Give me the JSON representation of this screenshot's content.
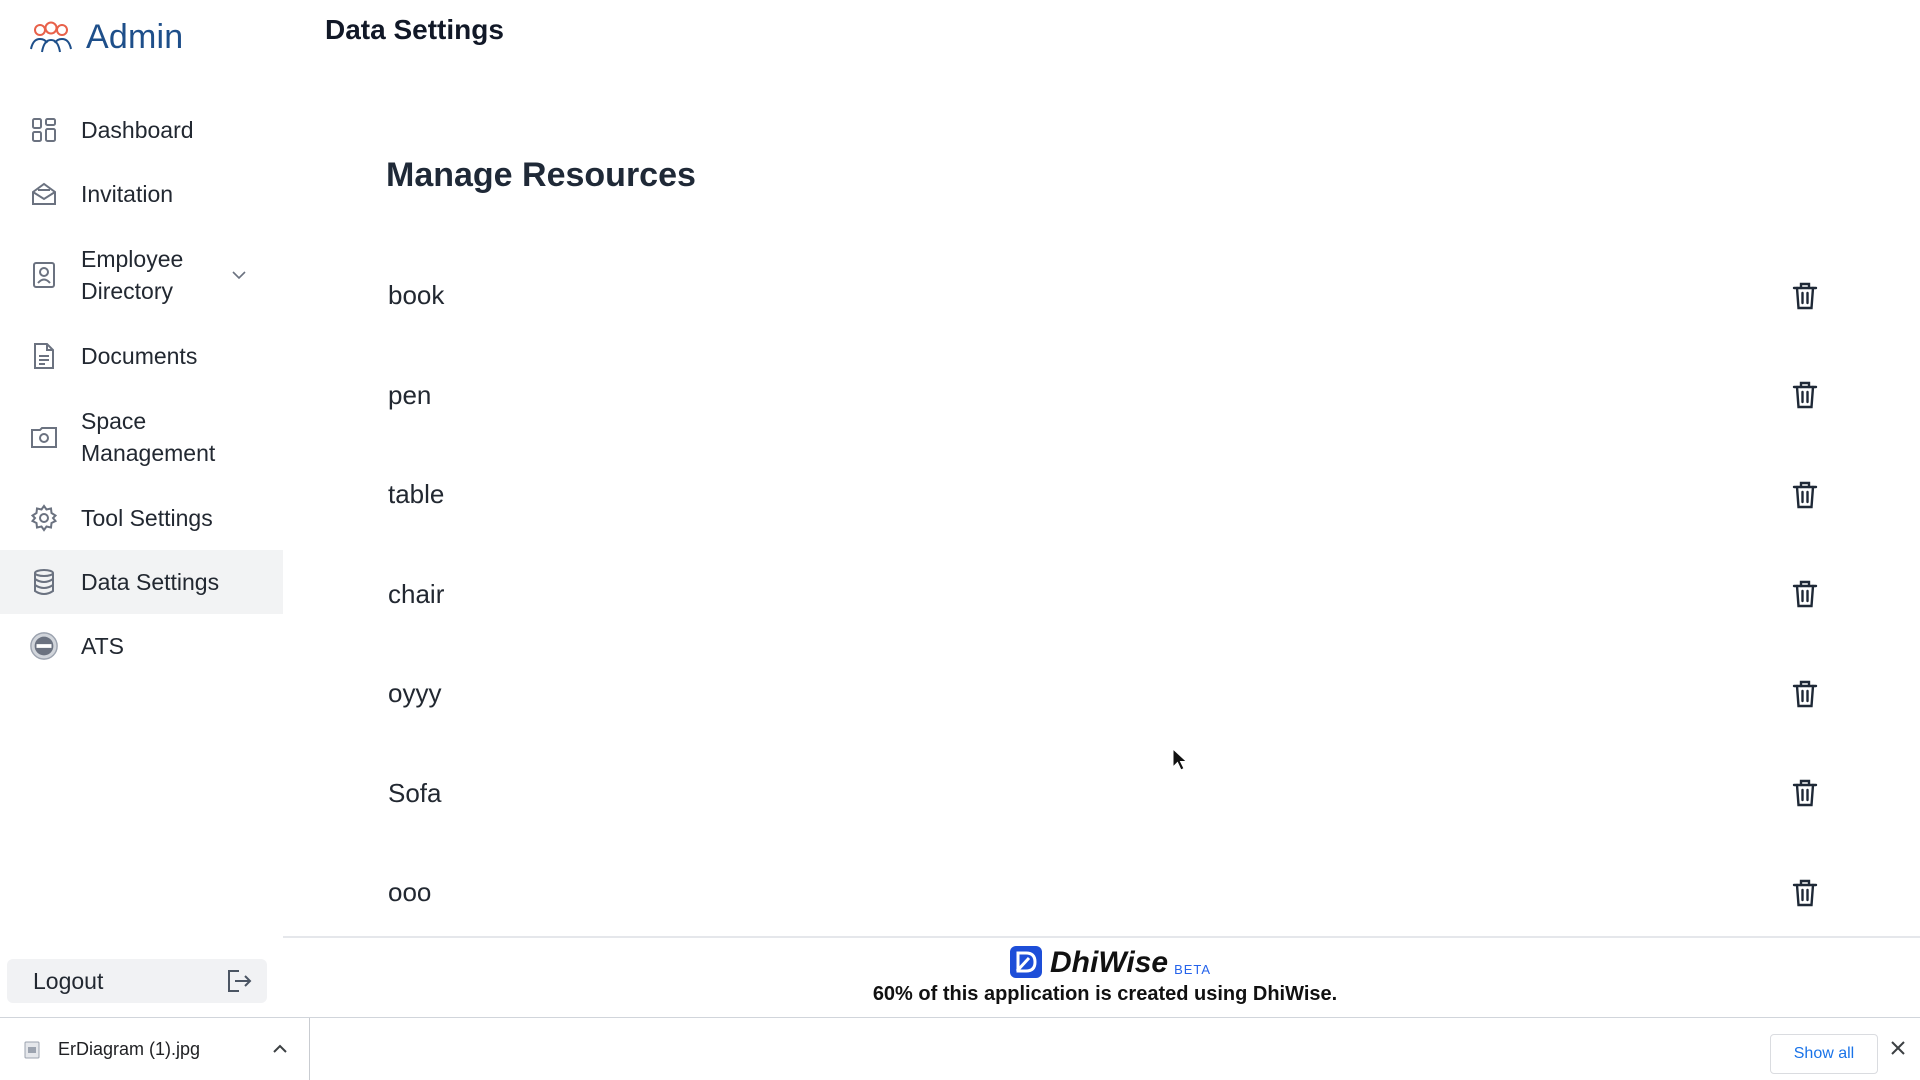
{
  "brand": {
    "name": "Admin",
    "icon": "users-group-icon"
  },
  "page": {
    "title": "Data Settings",
    "section_title": "Manage Resources"
  },
  "sidebar": {
    "items": [
      {
        "label": "Dashboard",
        "icon": "grid-icon"
      },
      {
        "label": "Invitation",
        "icon": "envelope-open-icon"
      },
      {
        "label": "Employee Directory",
        "icon": "id-badge-icon",
        "expandable": true
      },
      {
        "label": "Documents",
        "icon": "document-icon"
      },
      {
        "label": "Space Management",
        "icon": "camera-folder-icon"
      },
      {
        "label": "Tool Settings",
        "icon": "gear-icon"
      },
      {
        "label": "Data Settings",
        "icon": "database-icon",
        "active": true
      },
      {
        "label": "ATS",
        "icon": "vote-badge-icon"
      }
    ],
    "logout_label": "Logout"
  },
  "resources": [
    "book",
    "pen",
    "table",
    "chair",
    "oyyy",
    "Sofa",
    "ooo"
  ],
  "footer": {
    "brand_name": "DhiWise",
    "beta": "BETA",
    "note": "60% of this application is created using DhiWise."
  },
  "download_bar": {
    "file_name": "ErDiagram (1).jpg",
    "show_all": "Show all"
  },
  "colors": {
    "brand": "#1e4f8a",
    "active_bg": "#f2f3f4",
    "link_blue": "#1a73e8"
  }
}
